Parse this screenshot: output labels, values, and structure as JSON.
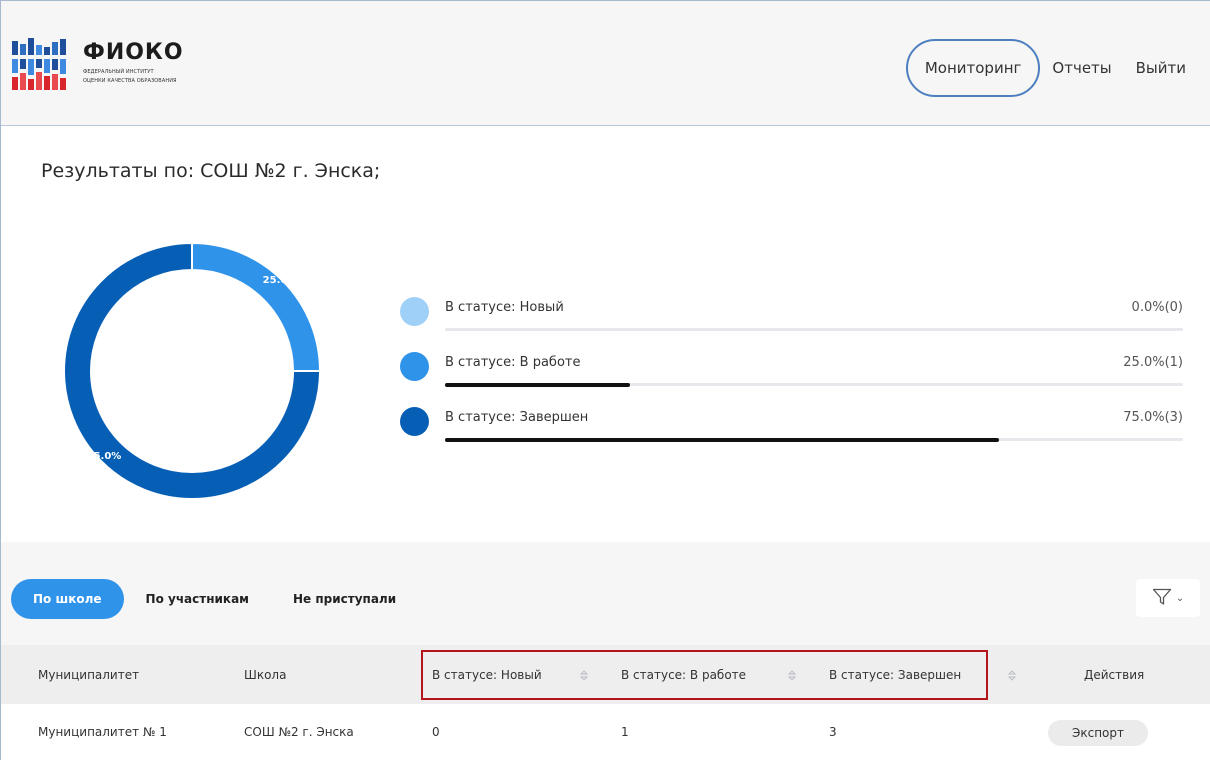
{
  "header": {
    "logo_title": "ФИОКО",
    "logo_subtitle_line1": "ФЕДЕРАЛЬНЫЙ ИНСТИТУТ",
    "logo_subtitle_line2": "ОЦЕНКИ КАЧЕСТВА ОБРАЗОВАНИЯ",
    "nav": [
      "Мониторинг",
      "Отчеты",
      "Выйти"
    ],
    "active_nav": "Мониторинг"
  },
  "results": {
    "title": "Результаты по: СОШ №2 г. Энска;"
  },
  "chart_data": {
    "type": "pie",
    "donut": true,
    "slices": [
      {
        "label": "В статусе: Новый",
        "percent": 0.0,
        "count": 0,
        "color": "#9fd0f8",
        "data_label": ""
      },
      {
        "label": "В статусе: В работе",
        "percent": 25.0,
        "count": 1,
        "color": "#2f93ea",
        "data_label": "25.0%"
      },
      {
        "label": "В статусе: Завершен",
        "percent": 75.0,
        "count": 3,
        "color": "#075fb5",
        "data_label": "75.0%"
      }
    ],
    "legend_placement": "right"
  },
  "legend": [
    {
      "label": "В статусе: Новый",
      "value": "0.0%(0)",
      "fill": 0.0,
      "color": "#9fd0f8"
    },
    {
      "label": "В статусе: В работе",
      "value": "25.0%(1)",
      "fill": 0.25,
      "color": "#2f93ea"
    },
    {
      "label": "В статусе: Завершен",
      "value": "75.0%(3)",
      "fill": 0.75,
      "color": "#075fb5"
    }
  ],
  "tabs": {
    "items": [
      "По школе",
      "По участникам",
      "Не приступали"
    ],
    "active": "По школе"
  },
  "filter": {
    "icon": "filter-icon",
    "chevron": "⌄"
  },
  "table": {
    "columns": [
      "Муниципалитет",
      "Школа",
      "В статусе: Новый",
      "В статусе: В работе",
      "В статусе: Завершен",
      "Действия"
    ],
    "rows": [
      {
        "municipality": "Муниципалитет № 1",
        "school": "СОШ №2 г. Энска",
        "new": "0",
        "in_work": "1",
        "completed": "3",
        "action": "Экспорт"
      }
    ],
    "highlight_color": "#b3141c"
  }
}
